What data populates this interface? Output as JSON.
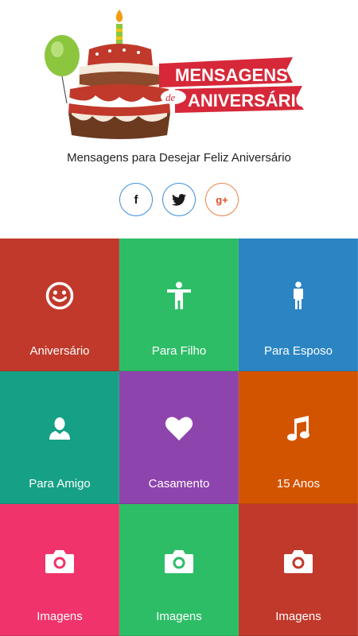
{
  "header": {
    "logo_text_line1": "MENSAGENS",
    "logo_text_de": "de",
    "logo_text_line2": "ANIVERSÁRIO",
    "subtitle": "Mensagens para Desejar Feliz Aniversário"
  },
  "social": [
    {
      "name": "facebook",
      "label": "f",
      "icon": "facebook-icon"
    },
    {
      "name": "twitter",
      "label": "",
      "icon": "twitter-icon"
    },
    {
      "name": "google-plus",
      "label": "g+",
      "icon": "google-plus-icon"
    }
  ],
  "tiles": [
    {
      "label": "Aniversário",
      "icon": "smiley-icon",
      "color": "#c0392b"
    },
    {
      "label": "Para Filho",
      "icon": "person-arms-open-icon",
      "color": "#2ebd67"
    },
    {
      "label": "Para Esposo",
      "icon": "man-icon",
      "color": "#2c85c3"
    },
    {
      "label": "Para Amigo",
      "icon": "user-icon",
      "color": "#16a085"
    },
    {
      "label": "Casamento",
      "icon": "heart-icon",
      "color": "#8e44ad"
    },
    {
      "label": "15 Anos",
      "icon": "music-note-icon",
      "color": "#d35400"
    },
    {
      "label": "Imagens",
      "icon": "camera-icon",
      "color": "#f0336a"
    },
    {
      "label": "Imagens",
      "icon": "camera-icon",
      "color": "#2ebd67"
    },
    {
      "label": "Imagens",
      "icon": "camera-icon",
      "color": "#c0392b"
    }
  ]
}
